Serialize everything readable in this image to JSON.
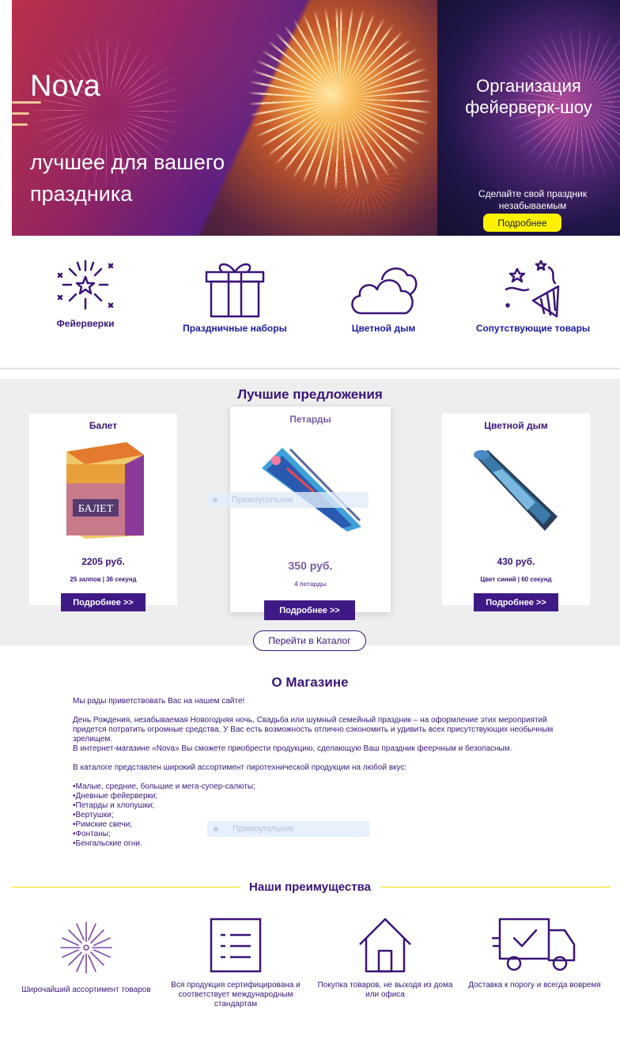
{
  "hero": {
    "brand": "Nova",
    "subtitle": "лучшее для вашего праздника"
  },
  "promo": {
    "title": "Организация фейерверк-шоу",
    "text": "Сделайте свой праздник незабываемым",
    "button": "Подробнее"
  },
  "categories": [
    {
      "label": "Фейерверки",
      "icon": "fireworks-icon"
    },
    {
      "label": "Праздничные наборы",
      "icon": "gift-icon"
    },
    {
      "label": "Цветной дым",
      "icon": "cloud-icon"
    },
    {
      "label": "Сопутствующие товары",
      "icon": "party-popper-icon"
    }
  ],
  "offers": {
    "title": "Лучшие предложения",
    "cards": [
      {
        "name": "Балет",
        "price": "2205 руб.",
        "desc": "25 залпов | 36 секунд",
        "button": "Подробнее >>"
      },
      {
        "name": "Петарды",
        "price": "350 руб.",
        "desc": "4 петарды",
        "button": "Подробнее >>"
      },
      {
        "name": "Цветной дым",
        "price": "430 руб.",
        "desc": "Цвет синий | 60 секунд",
        "button": "Подробнее >>"
      }
    ],
    "overlay_label": "Прямоугольник",
    "catalog_button": "Перейти в Каталог"
  },
  "about": {
    "title": "О Магазине",
    "greeting": "Мы рады приветствовать Вас на нашем сайте!",
    "para1": "День Рождения, незабываемая Новогодняя ночь, Свадьба или шумный семейный праздник – на оформление этих мероприятий придется потратить огромные средства. У Вас есть возможность отлично сэкономить и удивить всех присутствующих необычным зрелищем.",
    "para2": "В интернет-магазине «Nova» Вы сможете приобрести продукцию, сделающую Ваш праздник феерчным и безопасным.",
    "para3": "В каталоге представлен широкий ассортимент пиротехнической продукции на любой вкус:",
    "list": [
      "•Малые, средние, большие и мега-супер-салюты;",
      "•Дневные фейерверки;",
      "•Петарды и хлопушки;",
      "•Вертушки;",
      "•Римские свечи;",
      "•Фонтаны;",
      "•Бенгальские огни."
    ],
    "overlay_label": "Прямоугольник"
  },
  "advantages": {
    "title": "Наши преимущества",
    "items": [
      {
        "label": "Широчайший ассортимент товаров",
        "icon": "sparkle-icon"
      },
      {
        "label": "Вся продукция сертифицирована и соответствует международным стандартам",
        "icon": "checklist-icon"
      },
      {
        "label": "Покупка товаров, не выходя из дома или офиса",
        "icon": "house-icon"
      },
      {
        "label": "Доставка к порогу и всегда вовремя",
        "icon": "delivery-truck-icon"
      }
    ]
  },
  "colors": {
    "brand_purple": "#3a1478",
    "button_purple": "#3f1a86",
    "promo_yellow": "#fff200"
  }
}
